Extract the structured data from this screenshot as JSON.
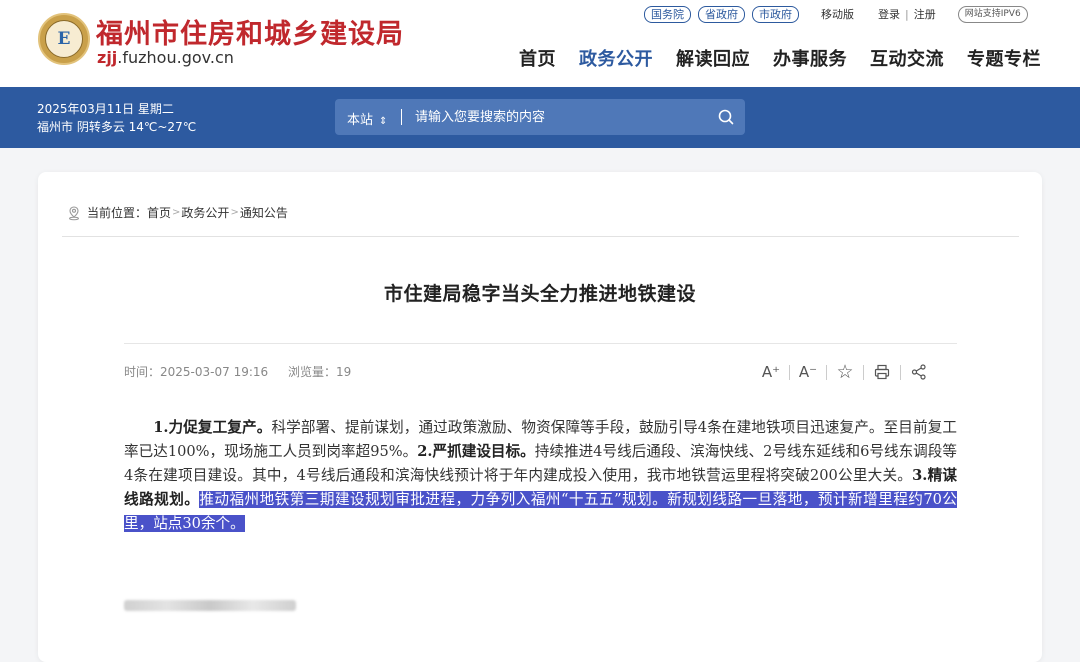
{
  "header": {
    "logo_glyph": "E",
    "site_title": "福州市住房和城乡建设局",
    "domain_accent": "zjj",
    "domain_rest": ".fuzhou.gov.cn",
    "top_links": [
      "国务院",
      "省政府",
      "市政府"
    ],
    "mobile": "移动版",
    "login": "登录",
    "register": "注册",
    "ipv6": "网站支持IPV6",
    "nav": [
      "首页",
      "政务公开",
      "解读回应",
      "办事服务",
      "互动交流",
      "专题专栏"
    ],
    "nav_active": "政务公开"
  },
  "bar": {
    "date": "2025年03月11日 星期二",
    "weather": "福州市 阴转多云 14℃~27℃",
    "search_scope": "本站",
    "search_placeholder": "请输入您要搜索的内容"
  },
  "breadcrumb": {
    "label": "当前位置：",
    "items": [
      "首页",
      "政务公开",
      "通知公告"
    ]
  },
  "article": {
    "title": "市住建局稳字当头全力推进地铁建设",
    "time_label": "时间：",
    "time": "2025-03-07 19:16",
    "views_label": "浏览量：",
    "views": "19",
    "seg1_bold": "1.力促复工复产。",
    "seg1": "科学部署、提前谋划，通过政策激励、物资保障等手段，鼓励引导4条在建地铁项目迅速复产。至目前复工率已达100%，现场施工人员到岗率超95%。",
    "seg2_bold": "2.严抓建设目标。",
    "seg2": "持续推进4号线后通段、滨海快线、2号线东延线和6号线东调段等4条在建项目建设。其中，4号线后通段和滨海快线预计将于年内建成投入使用，我市地铁营运里程将突破200公里大关。",
    "seg3_bold": "3.精谋线路规划。",
    "seg3_highlight": "推动福州地铁第三期建设规划审批进程，力争列入福州“十五五”规划。新规划线路一旦落地，预计新增里程约70公里，站点30余个。"
  },
  "tools": {
    "font_up": "A⁺",
    "font_down": "A⁻",
    "favorite_glyph": "☆"
  },
  "colors": {
    "brand_red": "#c0282d",
    "nav_blue": "#2d5aa0",
    "highlight": "#4a52c9"
  }
}
